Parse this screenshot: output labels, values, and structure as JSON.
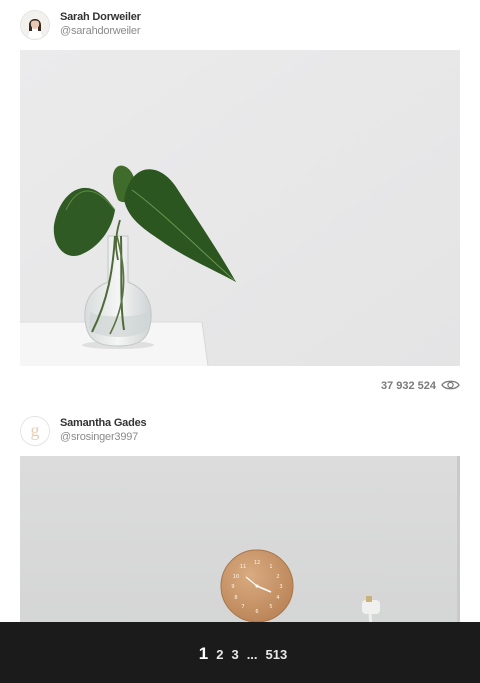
{
  "posts": [
    {
      "author_name": "Sarah Dorweiler",
      "author_handle": "@sarahdorweiler",
      "views": "37 932 524",
      "icon": "eye-icon"
    },
    {
      "author_name": "Samantha Gades",
      "author_handle": "@srosinger3997"
    }
  ],
  "pagination": {
    "current": "1",
    "pages": [
      "2",
      "3"
    ],
    "ellipsis": "...",
    "last": "513"
  }
}
